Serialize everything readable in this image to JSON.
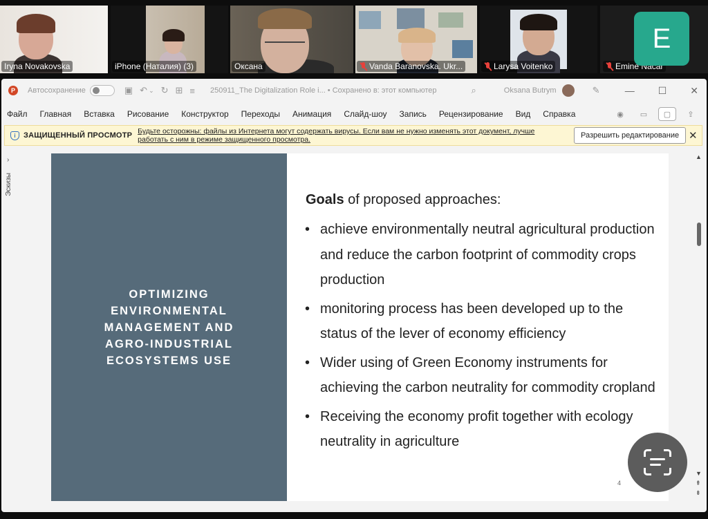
{
  "participants": [
    {
      "name": "Iryna Novakovska",
      "muted": false
    },
    {
      "name": "iPhone (Наталия) (3)",
      "muted": false
    },
    {
      "name": "Оксана",
      "muted": false,
      "active": true
    },
    {
      "name": "Vanda Baranovska. Ukr...",
      "muted": true
    },
    {
      "name": "Larysa Voitenko",
      "muted": true
    },
    {
      "name": "Emine Nacar",
      "muted": true,
      "avatar_letter": "E"
    }
  ],
  "titlebar": {
    "autosave_label": "Автосохранение",
    "document_title": "250911_The Digitalization Role i...  •  Сохранено в: этот компьютер",
    "user_name": "Oksana Butrym"
  },
  "menu": [
    "Файл",
    "Главная",
    "Вставка",
    "Рисование",
    "Конструктор",
    "Переходы",
    "Анимация",
    "Слайд-шоу",
    "Запись",
    "Рецензирование",
    "Вид",
    "Справка"
  ],
  "protected_view": {
    "label": "ЗАЩИЩЕННЫЙ ПРОСМОТР",
    "message": "Будьте осторожны: файлы из Интернета могут содержать вирусы. Если вам не нужно изменять этот документ, лучше работать с ним в режиме защищенного просмотра.",
    "enable_button": "Разрешить редактирование"
  },
  "thumbnails_label": "Эскизы",
  "slide": {
    "title": "OPTIMIZING\nENVIRONMENTAL\nMANAGEMENT AND\nAGRO-INDUSTRIAL\nECOSYSTEMS USE",
    "goals_bold": "Goals",
    "goals_rest": " of proposed approaches:",
    "bullets": [
      "achieve environmentally neutral agricultural production and reduce the carbon footprint of commodity crops production",
      "monitoring process has been developed up to the status of the lever of economy efficiency",
      "Wider using of Green Economy instruments for achieving the carbon neutrality for commodity cropland",
      "Receiving the economy profit together with ecology neutrality in agriculture"
    ],
    "number": "4"
  },
  "colors": {
    "slide_panel": "#566b7a",
    "active_tile": "#5cc97b",
    "avatar_bg": "#27a88d",
    "banner_bg": "#fdf6d3"
  }
}
